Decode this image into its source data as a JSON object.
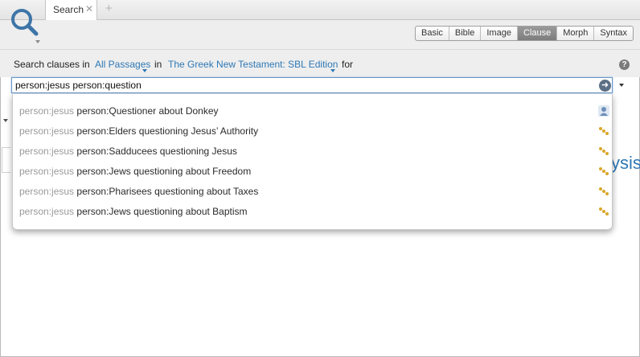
{
  "tab": {
    "label": "Search",
    "close": "✕",
    "add": "+"
  },
  "modes": [
    "Basic",
    "Bible",
    "Image",
    "Clause",
    "Morph",
    "Syntax"
  ],
  "active_mode": "Clause",
  "criteria": {
    "prefix": "Search clauses in",
    "range": "All Passages",
    "in": "in",
    "resource": "The Greek New Testament: SBL Edition",
    "for": "for"
  },
  "help": "?",
  "search": {
    "value": "person:jesus person:question",
    "go_glyph": "➜"
  },
  "underlying": {
    "partial_title": "ysis"
  },
  "suggestions": [
    {
      "prefix": "person:jesus",
      "term": "person:Questioner about Donkey",
      "icon": "person-icon"
    },
    {
      "prefix": "person:jesus",
      "term": "person:Elders questioning Jesus’ Authority",
      "icon": "group-icon"
    },
    {
      "prefix": "person:jesus",
      "term": "person:Sadducees questioning Jesus",
      "icon": "group-icon"
    },
    {
      "prefix": "person:jesus",
      "term": "person:Jews questioning about Freedom",
      "icon": "group-icon"
    },
    {
      "prefix": "person:jesus",
      "term": "person:Pharisees questioning about Taxes",
      "icon": "group-icon"
    },
    {
      "prefix": "person:jesus",
      "term": "person:Jews questioning about Baptism",
      "icon": "group-icon"
    }
  ],
  "colors": {
    "link": "#2f78b5",
    "person_icon": "#6d8fb8",
    "group_icon": "#d9a72b"
  }
}
